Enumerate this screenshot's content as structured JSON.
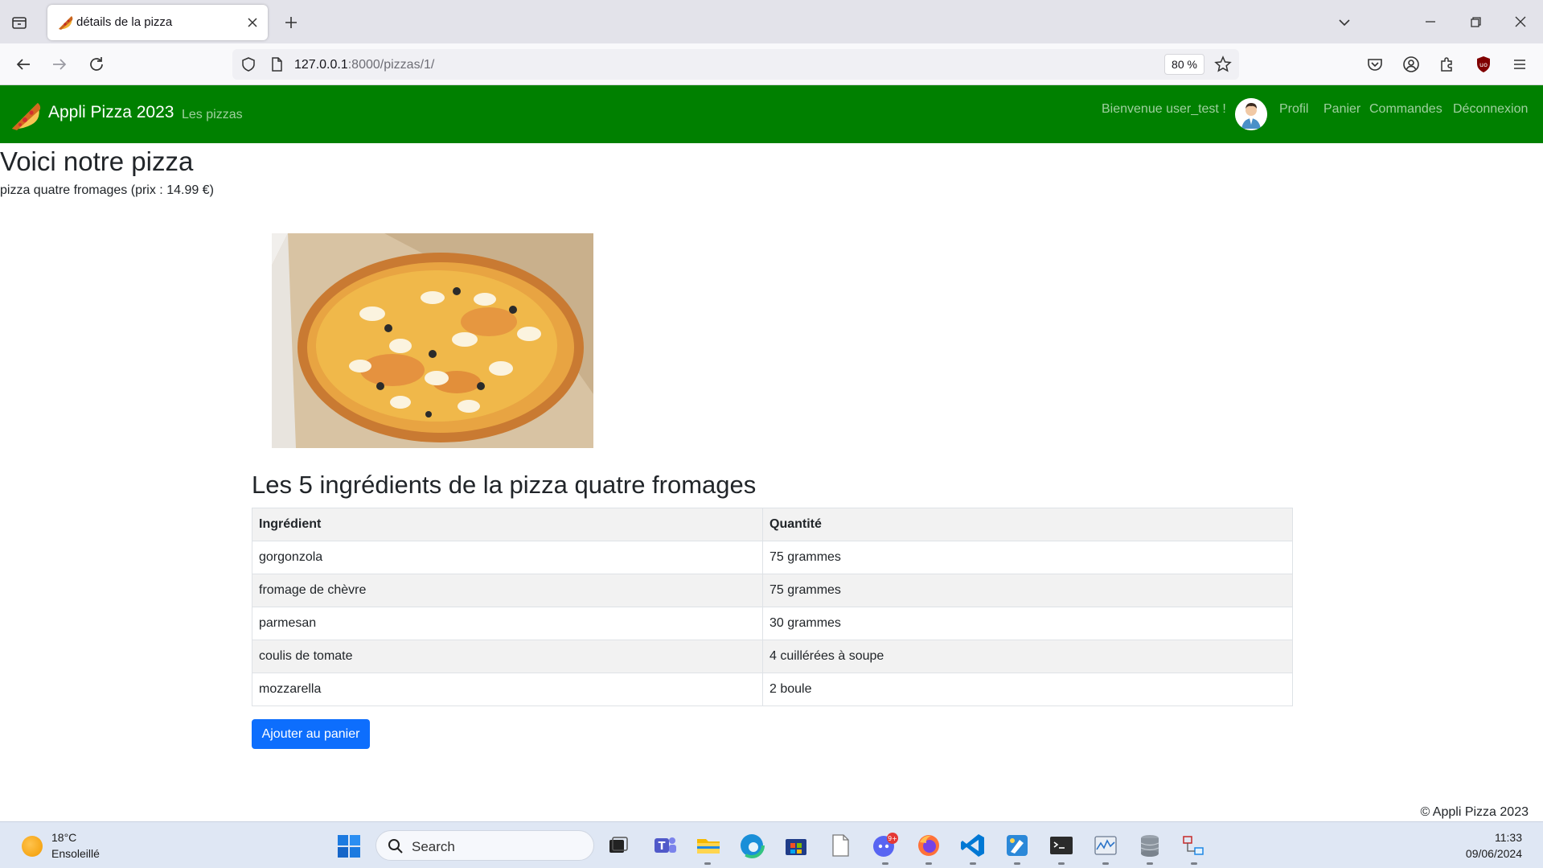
{
  "browser": {
    "tab_title": "détails de la pizza",
    "url_host": "127.0.0.1",
    "url_rest": ":8000/pizzas/1/",
    "zoom": "80 %"
  },
  "site": {
    "brand": "Appli Pizza 2023",
    "nav_pizzas": "Les pizzas",
    "welcome": "Bienvenue user_test !",
    "nav_profil": "Profil",
    "nav_panier": "Panier",
    "nav_commandes": "Commandes",
    "nav_deconnexion": "Déconnexion",
    "brand_color": "#008000"
  },
  "page": {
    "title": "Voici notre pizza",
    "subtitle": "pizza quatre fromages (prix : 14.99 €)",
    "ingredients_title": "Les 5 ingrédients de la pizza quatre fromages",
    "table_headers": [
      "Ingrédient",
      "Quantité"
    ],
    "ingredients": [
      {
        "name": "gorgonzola",
        "qty": "75 grammes"
      },
      {
        "name": "fromage de chèvre",
        "qty": "75 grammes"
      },
      {
        "name": "parmesan",
        "qty": "30 grammes"
      },
      {
        "name": "coulis de tomate",
        "qty": "4 cuillérées à soupe"
      },
      {
        "name": "mozzarella",
        "qty": "2 boule"
      }
    ],
    "add_button": "Ajouter au panier",
    "button_color": "#0d6efd",
    "footer": "© Appli Pizza 2023"
  },
  "taskbar": {
    "temp": "18°C",
    "weather": "Ensoleillé",
    "search_label": "Search",
    "time": "11:33",
    "date": "09/06/2024",
    "discord_badge": "9+"
  }
}
